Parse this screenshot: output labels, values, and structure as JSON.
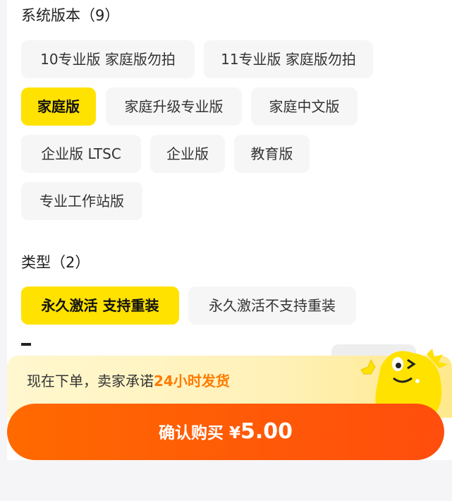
{
  "version_section": {
    "title": "系统版本（9）",
    "options": [
      {
        "label": "10专业版 家庭版勿拍",
        "selected": false
      },
      {
        "label": "11专业版 家庭版勿拍",
        "selected": false
      },
      {
        "label": "家庭版",
        "selected": true
      },
      {
        "label": "家庭升级专业版",
        "selected": false
      },
      {
        "label": "家庭中文版",
        "selected": false
      },
      {
        "label": "企业版 LTSC",
        "selected": false
      },
      {
        "label": "企业版",
        "selected": false
      },
      {
        "label": "教育版",
        "selected": false
      },
      {
        "label": "专业工作站版",
        "selected": false
      }
    ]
  },
  "type_section": {
    "title": "类型（2）",
    "options": [
      {
        "label": "永久激活 支持重装",
        "selected": true
      },
      {
        "label": "永久激活不支持重装",
        "selected": false
      }
    ]
  },
  "promo": {
    "text_prefix": "现在下单，卖家承诺",
    "text_highlight": "24小时发货"
  },
  "confirm": {
    "label": "确认购买",
    "currency": "¥",
    "price": "5.00"
  },
  "colors": {
    "accent_yellow": "#ffe200",
    "button_orange": "#ff5a0a",
    "highlight_orange": "#ff7a00"
  }
}
